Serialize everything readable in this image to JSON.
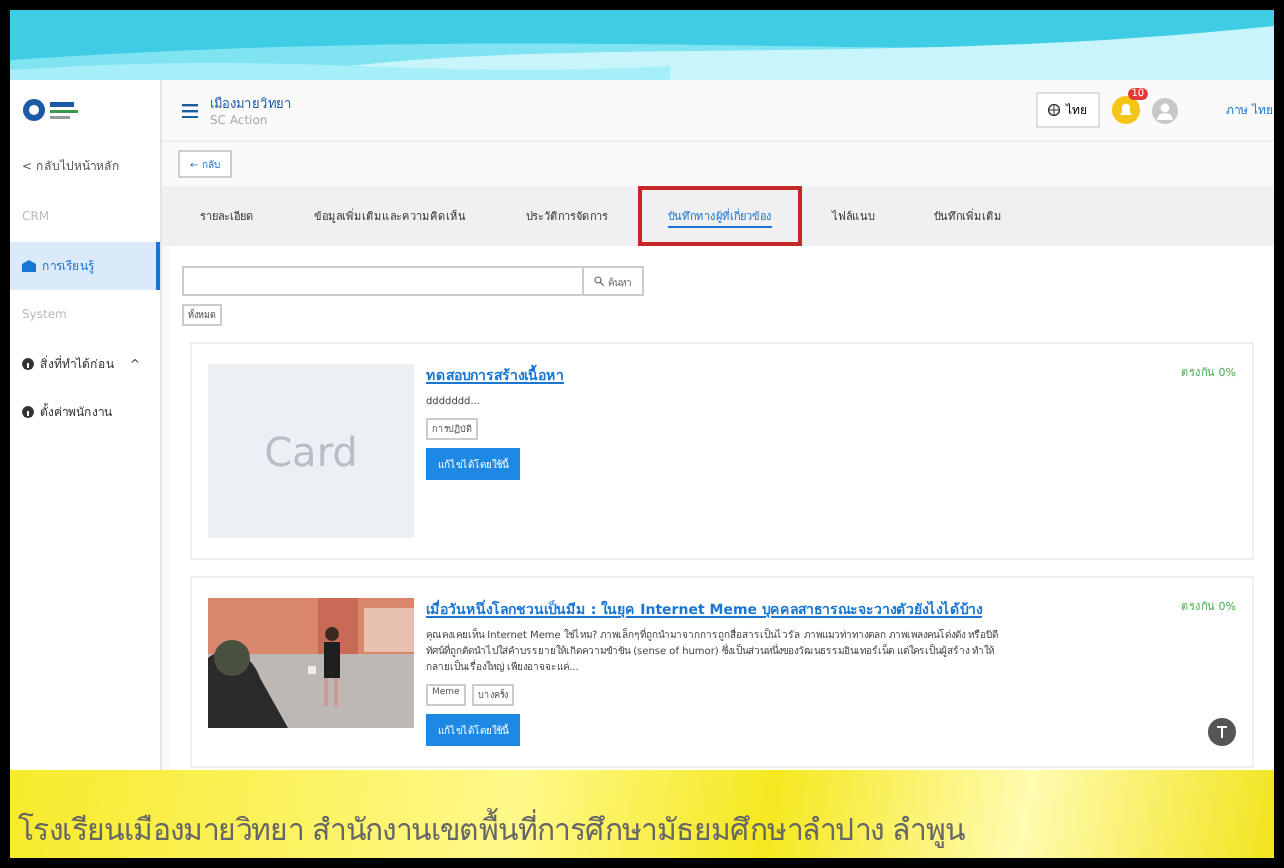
{
  "sidebar": {
    "back_link": "< กลับไปหน้าหลัก",
    "items": [
      {
        "kind": "section",
        "label": "CRM"
      },
      {
        "kind": "item",
        "label": "การเรียนรู้",
        "selected": true
      },
      {
        "kind": "section",
        "label": "System"
      },
      {
        "kind": "item",
        "label": "สิ่งที่ทำได้ก่อน",
        "expander": "^",
        "selected": false
      },
      {
        "kind": "item",
        "label": "ตั้งค่าพนักงาน",
        "selected": false
      }
    ]
  },
  "header": {
    "title": "เมืองมายวิทยา",
    "subtitle": "SC Action",
    "language_button": "ไทย",
    "notification_count": "10",
    "user_name": "ภาษ ไทย"
  },
  "back_button": "← กลับ",
  "tabs": [
    {
      "label": "รายละเอียด",
      "selected": false
    },
    {
      "label": "ข้อมูลเพิ่มเติมและความคิดเห็น",
      "selected": false
    },
    {
      "label": "ประวัติการจัดการ",
      "selected": false
    },
    {
      "label": "บันทึกทางผู้ที่เกี่ยวข้อง",
      "selected": true,
      "highlighted": true
    },
    {
      "label": "ไฟล์แนบ",
      "selected": false
    },
    {
      "label": "บันทึกเพิ่มเติม",
      "selected": false
    }
  ],
  "search": {
    "button": "ค้นหา",
    "filter_tag": "ทั้งหมด"
  },
  "cards": [
    {
      "kind": "placeholder",
      "image_text": "Card",
      "title": "ทดสอบการสร้างเนื้อหา",
      "description": "ddddddd...",
      "tags": [
        "การปฏิบัติ"
      ],
      "button": "แก้ไขได้โดยใช้นี้",
      "match": "ตรงกัน 0%"
    },
    {
      "kind": "picture",
      "title": "เมื่อวันหนึ่งโลกชวนเป็นมีม : ในยุค Internet Meme บุคคลสาธารณะจะวางตัวยังไงได้บ้าง",
      "description": "คุณคงเคยเห็น Internet Meme ใช่ไหม? ภาพเล็กๆที่ถูกนำมาจากการถูกสื่อสารเป็นไวรัล ภาพแมวท่าทางตลก ภาพเพลงคนโด่งดัง หรือบิดีทัศน์ที่ถูกตัดนำไปใส่คำบรรยายให้เกิดความขำขัน (sense of humor) ซึ่งเป็นส่วนหนึ่งของวัฒนธรรมอินเทอร์เน็ต แต่ใครเป็นผู้สร้าง ทำให้กลายเป็นเรื่องใหญ่ เพียงอาจจะแค่...",
      "tags": [
        "Meme",
        "บางครั้ง"
      ],
      "button": "แก้ไขได้โดยใช้นี้",
      "match": "ตรงกัน 0%"
    }
  ],
  "footer_banner": "โรงเรียนเมืองมายวิทยา  สำนักงานเขตพื้นที่การศึกษามัธยมศึกษาลำปาง  ลำพูน"
}
